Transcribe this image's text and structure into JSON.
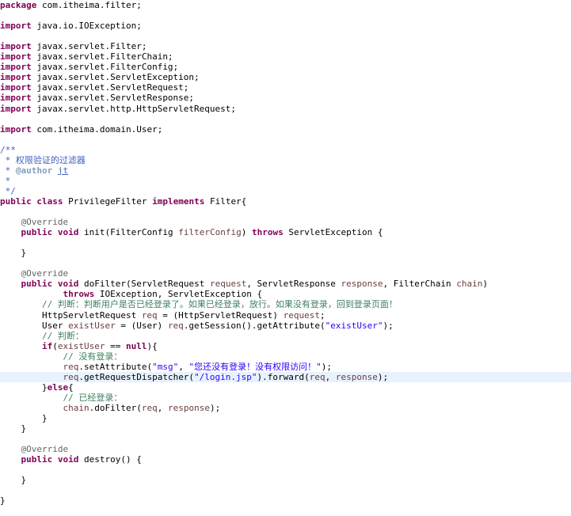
{
  "editor": {
    "language": "java",
    "current_line": 36,
    "lines": [
      [
        [
          "kw",
          "package"
        ],
        [
          "t",
          " com.itheima.filter;"
        ]
      ],
      [],
      [
        [
          "kw",
          "import"
        ],
        [
          "t",
          " java.io.IOException;"
        ]
      ],
      [],
      [
        [
          "kw",
          "import"
        ],
        [
          "t",
          " javax.servlet.Filter;"
        ]
      ],
      [
        [
          "kw",
          "import"
        ],
        [
          "t",
          " javax.servlet.FilterChain;"
        ]
      ],
      [
        [
          "kw",
          "import"
        ],
        [
          "t",
          " javax.servlet.FilterConfig;"
        ]
      ],
      [
        [
          "kw",
          "import"
        ],
        [
          "t",
          " javax.servlet.ServletException;"
        ]
      ],
      [
        [
          "kw",
          "import"
        ],
        [
          "t",
          " javax.servlet.ServletRequest;"
        ]
      ],
      [
        [
          "kw",
          "import"
        ],
        [
          "t",
          " javax.servlet.ServletResponse;"
        ]
      ],
      [
        [
          "kw",
          "import"
        ],
        [
          "t",
          " javax.servlet.http.HttpServletRequest;"
        ]
      ],
      [],
      [
        [
          "kw",
          "import"
        ],
        [
          "t",
          " com.itheima.domain.User;"
        ]
      ],
      [],
      [
        [
          "jdoc",
          "/**"
        ]
      ],
      [
        [
          "jdoc",
          " * 权限验证的过滤器"
        ]
      ],
      [
        [
          "jdoc",
          " * "
        ],
        [
          "jtag",
          "@author"
        ],
        [
          "jdoc",
          " "
        ],
        [
          "jdocu",
          "jt"
        ]
      ],
      [
        [
          "jdoc",
          " *"
        ]
      ],
      [
        [
          "jdoc",
          " */"
        ]
      ],
      [
        [
          "kw",
          "public"
        ],
        [
          "t",
          " "
        ],
        [
          "kw",
          "class"
        ],
        [
          "t",
          " PrivilegeFilter "
        ],
        [
          "kw",
          "implements"
        ],
        [
          "t",
          " Filter{"
        ]
      ],
      [],
      [
        [
          "t",
          "    "
        ],
        [
          "ann",
          "@Override"
        ]
      ],
      [
        [
          "t",
          "    "
        ],
        [
          "kw",
          "public"
        ],
        [
          "t",
          " "
        ],
        [
          "kw",
          "void"
        ],
        [
          "t",
          " init(FilterConfig "
        ],
        [
          "var",
          "filterConfig"
        ],
        [
          "t",
          ") "
        ],
        [
          "kw",
          "throws"
        ],
        [
          "t",
          " ServletException {"
        ]
      ],
      [],
      [
        [
          "t",
          "    }"
        ]
      ],
      [],
      [
        [
          "t",
          "    "
        ],
        [
          "ann",
          "@Override"
        ]
      ],
      [
        [
          "t",
          "    "
        ],
        [
          "kw",
          "public"
        ],
        [
          "t",
          " "
        ],
        [
          "kw",
          "void"
        ],
        [
          "t",
          " doFilter(ServletRequest "
        ],
        [
          "var",
          "request"
        ],
        [
          "t",
          ", ServletResponse "
        ],
        [
          "var",
          "response"
        ],
        [
          "t",
          ", FilterChain "
        ],
        [
          "var",
          "chain"
        ],
        [
          "t",
          ")"
        ]
      ],
      [
        [
          "t",
          "            "
        ],
        [
          "kw",
          "throws"
        ],
        [
          "t",
          " IOException, ServletException {"
        ]
      ],
      [
        [
          "t",
          "        "
        ],
        [
          "cmt",
          "// 判断：判断用户是否已经登录了。如果已经登录，放行。如果没有登录，回到登录页面！"
        ]
      ],
      [
        [
          "t",
          "        HttpServletRequest "
        ],
        [
          "var",
          "req"
        ],
        [
          "t",
          " = (HttpServletRequest) "
        ],
        [
          "var",
          "request"
        ],
        [
          "t",
          ";"
        ]
      ],
      [
        [
          "t",
          "        User "
        ],
        [
          "var",
          "existUser"
        ],
        [
          "t",
          " = (User) "
        ],
        [
          "var",
          "req"
        ],
        [
          "t",
          ".getSession().getAttribute("
        ],
        [
          "str",
          "\"existUser\""
        ],
        [
          "t",
          ");"
        ]
      ],
      [
        [
          "t",
          "        "
        ],
        [
          "cmt",
          "// 判断："
        ]
      ],
      [
        [
          "t",
          "        "
        ],
        [
          "kw",
          "if"
        ],
        [
          "t",
          "("
        ],
        [
          "var",
          "existUser"
        ],
        [
          "t",
          " == "
        ],
        [
          "kw",
          "null"
        ],
        [
          "t",
          "){"
        ]
      ],
      [
        [
          "t",
          "            "
        ],
        [
          "cmt",
          "// 没有登录："
        ]
      ],
      [
        [
          "t",
          "            "
        ],
        [
          "var",
          "req"
        ],
        [
          "t",
          ".setAttribute("
        ],
        [
          "str",
          "\"msg\""
        ],
        [
          "t",
          ", "
        ],
        [
          "str",
          "\"您还没有登录！没有权限访问！\""
        ],
        [
          "t",
          ");"
        ]
      ],
      [
        [
          "t",
          "            "
        ],
        [
          "var",
          "req"
        ],
        [
          "t",
          ".getRequestDispatcher("
        ],
        [
          "str",
          "\"/login.jsp\""
        ],
        [
          "t",
          ").forward("
        ],
        [
          "var",
          "req"
        ],
        [
          "t",
          ", "
        ],
        [
          "var",
          "response"
        ],
        [
          "t",
          ");"
        ]
      ],
      [
        [
          "t",
          "        }"
        ],
        [
          "kw",
          "else"
        ],
        [
          "t",
          "{"
        ]
      ],
      [
        [
          "t",
          "            "
        ],
        [
          "cmt",
          "// 已经登录："
        ]
      ],
      [
        [
          "t",
          "            "
        ],
        [
          "var",
          "chain"
        ],
        [
          "t",
          ".doFilter("
        ],
        [
          "var",
          "req"
        ],
        [
          "t",
          ", "
        ],
        [
          "var",
          "response"
        ],
        [
          "t",
          ");"
        ]
      ],
      [
        [
          "t",
          "        }"
        ]
      ],
      [
        [
          "t",
          "    }"
        ]
      ],
      [],
      [
        [
          "t",
          "    "
        ],
        [
          "ann",
          "@Override"
        ]
      ],
      [
        [
          "t",
          "    "
        ],
        [
          "kw",
          "public"
        ],
        [
          "t",
          " "
        ],
        [
          "kw",
          "void"
        ],
        [
          "t",
          " destroy() {"
        ]
      ],
      [],
      [
        [
          "t",
          "    }"
        ]
      ],
      [],
      [
        [
          "t",
          "}"
        ]
      ]
    ]
  }
}
